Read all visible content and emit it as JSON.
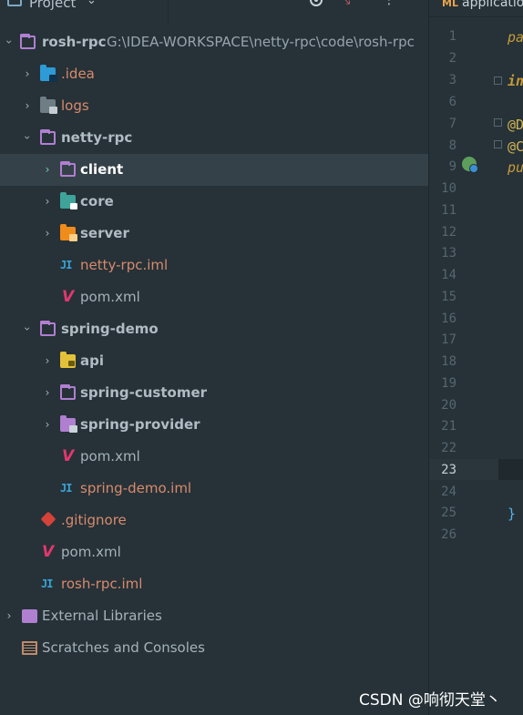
{
  "header": {
    "title": "Project",
    "dropdown_glyph": "⌄"
  },
  "tree": [
    {
      "label": "rosh-rpc",
      "path": "G:\\IDEA-WORKSPACE\\netty-rpc\\code\\rosh-rpc",
      "icon": "module-folder-icon"
    },
    {
      "label": ".idea",
      "icon": "idea-folder-icon"
    },
    {
      "label": "logs",
      "icon": "logs-folder-icon"
    },
    {
      "label": "netty-rpc",
      "icon": "module-folder-icon"
    },
    {
      "label": "client",
      "icon": "module-folder-icon"
    },
    {
      "label": "core",
      "icon": "core-folder-icon"
    },
    {
      "label": "server",
      "icon": "server-folder-icon"
    },
    {
      "label": "netty-rpc.iml",
      "icon": "iml-file-icon"
    },
    {
      "label": "pom.xml",
      "icon": "maven-pom-icon"
    },
    {
      "label": "spring-demo",
      "icon": "module-folder-icon"
    },
    {
      "label": "api",
      "icon": "api-folder-icon"
    },
    {
      "label": "spring-customer",
      "icon": "module-folder-icon"
    },
    {
      "label": "spring-provider",
      "icon": "provider-folder-icon"
    },
    {
      "label": "pom.xml",
      "icon": "maven-pom-icon"
    },
    {
      "label": "spring-demo.iml",
      "icon": "iml-file-icon"
    },
    {
      "label": ".gitignore",
      "icon": "gitignore-icon"
    },
    {
      "label": "pom.xml",
      "icon": "maven-pom-icon"
    },
    {
      "label": "rosh-rpc.iml",
      "icon": "iml-file-icon"
    },
    {
      "label": "External Libraries",
      "icon": "libraries-icon"
    },
    {
      "label": "Scratches and Consoles",
      "icon": "scratches-icon"
    }
  ],
  "editor": {
    "tab_label": "applicatio",
    "tab_icon": "ML",
    "line_numbers": [
      "1",
      "2",
      "3",
      "6",
      "7",
      "8",
      "9",
      "10",
      "11",
      "12",
      "13",
      "14",
      "15",
      "16",
      "17",
      "18",
      "19",
      "20",
      "21",
      "22",
      "23",
      "24",
      "25",
      "26"
    ],
    "current_line": "23",
    "code": {
      "l1": "pa",
      "l3": "in",
      "l7": "@D",
      "l8": "@C",
      "l9": "pu",
      "l25": "}"
    }
  },
  "colors": {
    "bg": "#263238",
    "selected_row": "#344149",
    "accent_folder": "#b07fd0",
    "file_text": "#d98a6c"
  },
  "watermark": "CSDN @响彻天堂丶"
}
